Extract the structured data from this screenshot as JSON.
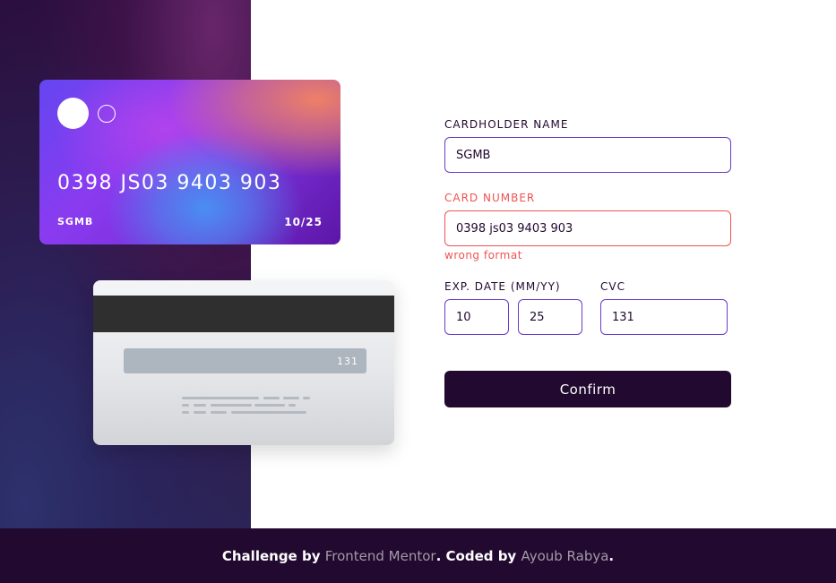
{
  "card_front": {
    "number": "0398 JS03 9403 903",
    "name": "SGMB",
    "expiry": "10/25"
  },
  "card_back": {
    "cvc": "131"
  },
  "form": {
    "cardholder_label": "CARDHOLDER NAME",
    "cardholder_value": "SGMB",
    "number_label": "CARD NUMBER",
    "number_value": "0398 js03 9403 903",
    "number_error": "wrong format",
    "exp_label": "EXP. DATE (MM/YY)",
    "exp_month": "10",
    "exp_year": "25",
    "cvc_label": "CVC",
    "cvc_value": "131",
    "confirm_label": "Confirm"
  },
  "footer": {
    "challenge_text": "Challenge by",
    "challenge_link": "Frontend Mentor",
    "sep": ".",
    "coded_text": "Coded by",
    "author_link": "Ayoub Rabya",
    "end": "."
  },
  "colors": {
    "dark": "#21092f",
    "error": "#ee5353",
    "active_border": "#6a3bc8"
  }
}
